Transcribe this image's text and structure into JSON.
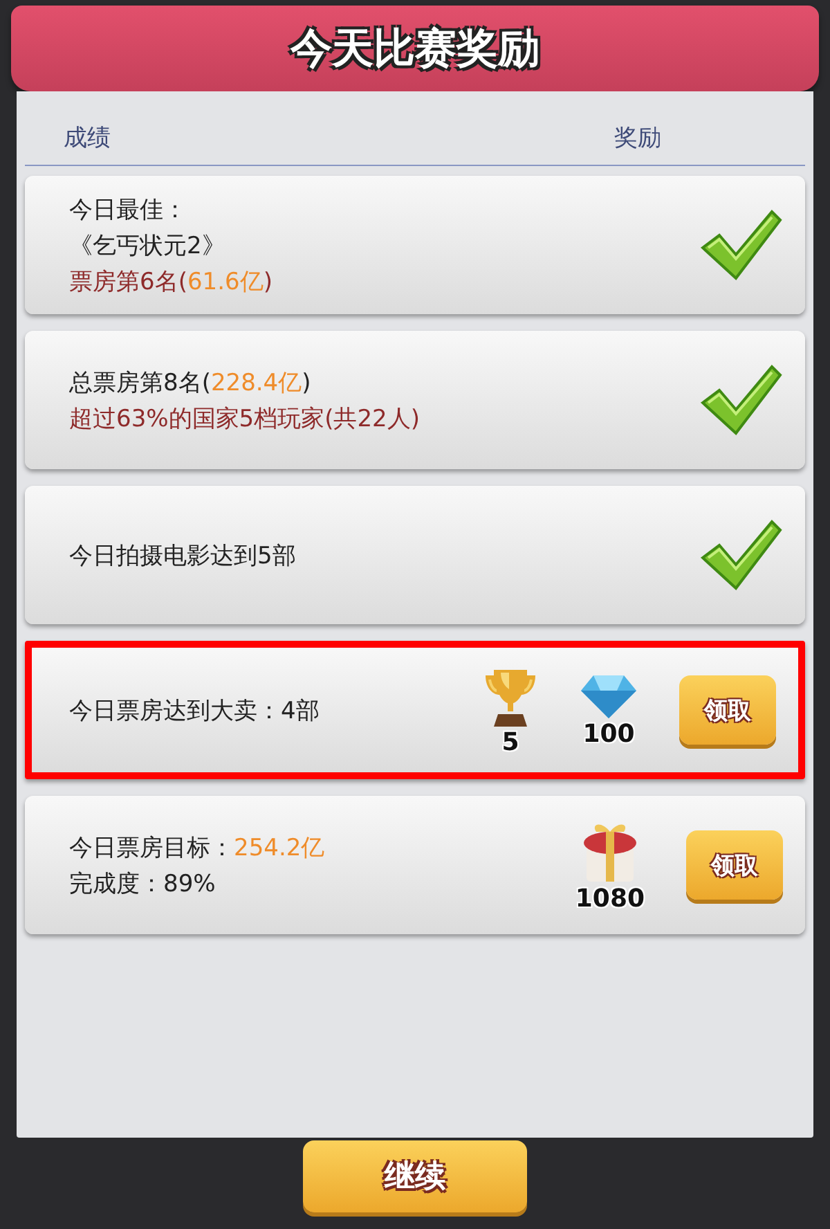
{
  "title": "今天比赛奖励",
  "columns": [
    "成绩",
    "奖励"
  ],
  "rows": [
    {
      "lines": [
        [
          {
            "text": "今日最佳：",
            "color": "#222222"
          }
        ],
        [
          {
            "text": "《乞丐状元2》",
            "color": "#222222"
          }
        ],
        [
          {
            "text": "票房第6名(",
            "color": "#8e2a2a"
          },
          {
            "text": "61.6亿",
            "color": "#ef8c2a"
          },
          {
            "text": ")",
            "color": "#8e2a2a"
          }
        ]
      ],
      "done": true,
      "highlighted": false
    },
    {
      "lines": [
        [
          {
            "text": "总票房第8名(",
            "color": "#222222"
          },
          {
            "text": "228.4亿",
            "color": "#ef8c2a"
          },
          {
            "text": ")",
            "color": "#222222"
          }
        ],
        [
          {
            "text": "超过63%的国家5档玩家(共22人)",
            "color": "#8e2a2a"
          }
        ]
      ],
      "done": true,
      "highlighted": false
    },
    {
      "lines": [
        [
          {
            "text": "今日拍摄电影达到5部",
            "color": "#222222"
          }
        ]
      ],
      "done": true,
      "highlighted": false
    },
    {
      "lines": [
        [
          {
            "text": "今日票房达到大卖：4部",
            "color": "#222222"
          }
        ]
      ],
      "done": false,
      "highlighted": true,
      "rewards": [
        {
          "kind": "trophy",
          "amount": "5"
        },
        {
          "kind": "diamond",
          "amount": "100"
        }
      ],
      "button": "领取"
    },
    {
      "lines": [
        [
          {
            "text": "今日票房目标：",
            "color": "#222222"
          },
          {
            "text": "254.2亿",
            "color": "#ef8c2a"
          }
        ],
        [
          {
            "text": "完成度：89%",
            "color": "#222222"
          }
        ]
      ],
      "done": false,
      "highlighted": false,
      "rewards": [
        {
          "kind": "gift",
          "amount": "1080"
        }
      ],
      "button": "领取"
    }
  ],
  "continue_button": "继续"
}
